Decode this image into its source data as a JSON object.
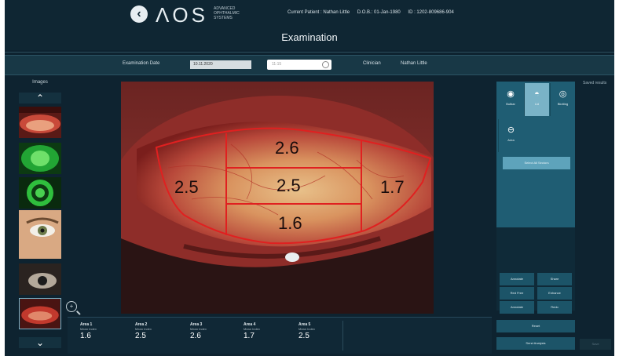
{
  "header": {
    "back_icon": "chevron-left-icon",
    "logo": "ΛOS",
    "logo_sub": "ADVANCED OPHTHALMIC SYSTEMS",
    "patient_label": "Current Patient : Nathan Little",
    "dob_label": "D.O.B.: 01-Jan-1980",
    "id_label": "ID : 1202-809686-904",
    "page_title": "Examination"
  },
  "exam_bar": {
    "date_label": "Examination Date",
    "date_value": "10.11.2020",
    "time_placeholder": "11:15",
    "clinician_label": "Clinician",
    "clinician_value": "Nathan Little"
  },
  "images": {
    "label": "Images",
    "up_icon": "chevron-up-icon",
    "down_icon": "chevron-down-icon",
    "thumbnails": [
      {
        "name": "thumb-redness"
      },
      {
        "name": "thumb-fluorescein"
      },
      {
        "name": "thumb-meibography"
      },
      {
        "name": "thumb-face"
      },
      {
        "name": "thumb-lid"
      },
      {
        "name": "thumb-bulbar"
      }
    ],
    "zoom_icon": "zoom-in-icon"
  },
  "grading": {
    "overlay_color": "#e02020",
    "values": [
      "2.6",
      "2.5",
      "2.5",
      "1.7",
      "1.6"
    ]
  },
  "areas": [
    {
      "name": "Area 1",
      "sub": "Mean Index",
      "value": "1.6"
    },
    {
      "name": "Area 2",
      "sub": "Mean Index",
      "value": "2.5"
    },
    {
      "name": "Area 3",
      "sub": "Mean Index",
      "value": "2.6"
    },
    {
      "name": "Area 4",
      "sub": "Mean Index",
      "value": "1.7"
    },
    {
      "name": "Area 5",
      "sub": "Mean Index",
      "value": "2.5"
    }
  ],
  "right_panel": {
    "tools": [
      {
        "label": "Bulbar",
        "icon": "eye-icon",
        "active": false
      },
      {
        "label": "Lid",
        "icon": "lid-icon",
        "active": true
      },
      {
        "label": "Blotting",
        "icon": "target-icon",
        "active": false
      },
      {
        "label": "Area",
        "icon": "area-icon",
        "active": false
      }
    ],
    "select_all": "Select All Sectors",
    "saved_results": "Saved results",
    "small_buttons": [
      "Annotate",
      "Share",
      "Red Free",
      "Enhance",
      "Annotate",
      "Redo"
    ],
    "reset": "Reset",
    "send_analysis": "Send Analysis",
    "dim_button": "Save"
  }
}
